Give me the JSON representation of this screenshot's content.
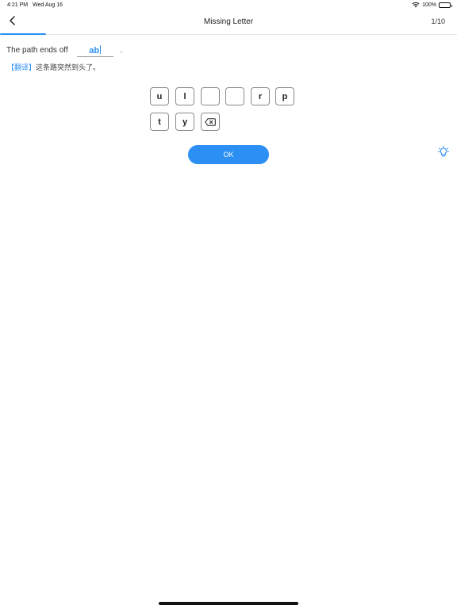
{
  "status_bar": {
    "time": "4:21 PM",
    "date": "Wed Aug 16",
    "battery": "100%"
  },
  "nav": {
    "title": "Missing Letter",
    "counter": "1/10",
    "progress": 0.1
  },
  "question": {
    "sentence_prefix": "The path ends off",
    "answer_value": "ab",
    "sentence_suffix": ".",
    "translation_tag": "【翻译】",
    "translation_text": "这条路突然到头了。"
  },
  "keyboard": {
    "keys": [
      "u",
      "l",
      "",
      "",
      "r",
      "p",
      "t",
      "y"
    ],
    "delete_icon": "backspace-icon"
  },
  "actions": {
    "ok_label": "OK",
    "hint_icon": "lightbulb-icon"
  },
  "colors": {
    "accent": "#2b8ff3"
  }
}
